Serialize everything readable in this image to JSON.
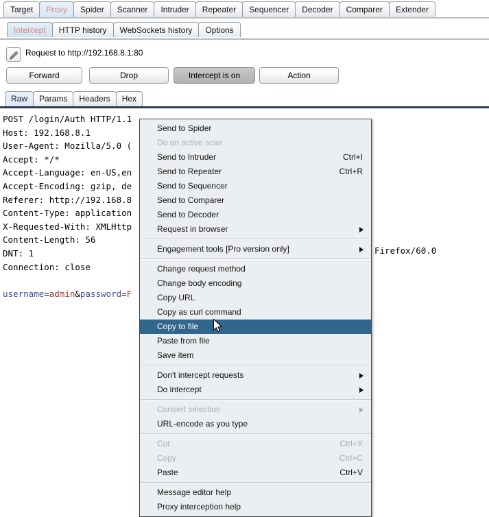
{
  "main_tabs": [
    {
      "label": "Target",
      "selected": false
    },
    {
      "label": "Proxy",
      "selected": true
    },
    {
      "label": "Spider",
      "selected": false
    },
    {
      "label": "Scanner",
      "selected": false
    },
    {
      "label": "Intruder",
      "selected": false
    },
    {
      "label": "Repeater",
      "selected": false
    },
    {
      "label": "Sequencer",
      "selected": false
    },
    {
      "label": "Decoder",
      "selected": false
    },
    {
      "label": "Comparer",
      "selected": false
    },
    {
      "label": "Extender",
      "selected": false
    }
  ],
  "sub_tabs": [
    {
      "label": "Intercept",
      "selected": true
    },
    {
      "label": "HTTP history",
      "selected": false
    },
    {
      "label": "WebSockets history",
      "selected": false
    },
    {
      "label": "Options",
      "selected": false
    }
  ],
  "request": {
    "title": "Request to http://192.168.8.1:80",
    "edit_icon": "pencil-icon"
  },
  "actions": {
    "forward": "Forward",
    "drop": "Drop",
    "intercept": "Intercept is on",
    "action": "Action"
  },
  "editor_tabs": [
    {
      "label": "Raw",
      "selected": true
    },
    {
      "label": "Params",
      "selected": false
    },
    {
      "label": "Headers",
      "selected": false
    },
    {
      "label": "Hex",
      "selected": false
    }
  ],
  "message": {
    "line1": "POST /login/Auth HTTP/1.1",
    "line2": "Host: 192.168.8.1",
    "line3": "User-Agent: Mozilla/5.0 (",
    "line4": "Accept: */*",
    "line5": "Accept-Language: en-US,en",
    "line6": "Accept-Encoding: gzip, de",
    "line7": "Referer: http://192.168.8",
    "line8": "Content-Type: application",
    "line9": "X-Requested-With: XMLHttp",
    "line10": "Content-Length: 56",
    "line11": "DNT: 1",
    "line12": "Connection: close",
    "body_key1": "username",
    "body_eq1": "=",
    "body_val1": "admin",
    "body_amp": "&",
    "body_key2": "password",
    "body_eq2": "=",
    "body_val2": "F",
    "overflow": "Firefox/60.0"
  },
  "context_menu": {
    "groups": [
      {
        "items": [
          {
            "label": "Send to Spider",
            "accel": "",
            "disabled": false,
            "submenu": false,
            "highlight": false
          },
          {
            "label": "Do an active scan",
            "accel": "",
            "disabled": true,
            "submenu": false,
            "highlight": false
          },
          {
            "label": "Send to Intruder",
            "accel": "Ctrl+I",
            "disabled": false,
            "submenu": false,
            "highlight": false
          },
          {
            "label": "Send to Repeater",
            "accel": "Ctrl+R",
            "disabled": false,
            "submenu": false,
            "highlight": false
          },
          {
            "label": "Send to Sequencer",
            "accel": "",
            "disabled": false,
            "submenu": false,
            "highlight": false
          },
          {
            "label": "Send to Comparer",
            "accel": "",
            "disabled": false,
            "submenu": false,
            "highlight": false
          },
          {
            "label": "Send to Decoder",
            "accel": "",
            "disabled": false,
            "submenu": false,
            "highlight": false
          },
          {
            "label": "Request in browser",
            "accel": "",
            "disabled": false,
            "submenu": true,
            "highlight": false
          }
        ]
      },
      {
        "items": [
          {
            "label": "Engagement tools [Pro version only]",
            "accel": "",
            "disabled": false,
            "submenu": true,
            "highlight": false
          }
        ]
      },
      {
        "items": [
          {
            "label": "Change request method",
            "accel": "",
            "disabled": false,
            "submenu": false,
            "highlight": false
          },
          {
            "label": "Change body encoding",
            "accel": "",
            "disabled": false,
            "submenu": false,
            "highlight": false
          },
          {
            "label": "Copy URL",
            "accel": "",
            "disabled": false,
            "submenu": false,
            "highlight": false
          },
          {
            "label": "Copy as curl command",
            "accel": "",
            "disabled": false,
            "submenu": false,
            "highlight": false
          },
          {
            "label": "Copy to file",
            "accel": "",
            "disabled": false,
            "submenu": false,
            "highlight": true
          },
          {
            "label": "Paste from file",
            "accel": "",
            "disabled": false,
            "submenu": false,
            "highlight": false
          },
          {
            "label": "Save item",
            "accel": "",
            "disabled": false,
            "submenu": false,
            "highlight": false
          }
        ]
      },
      {
        "items": [
          {
            "label": "Don't intercept requests",
            "accel": "",
            "disabled": false,
            "submenu": true,
            "highlight": false
          },
          {
            "label": "Do intercept",
            "accel": "",
            "disabled": false,
            "submenu": true,
            "highlight": false
          }
        ]
      },
      {
        "items": [
          {
            "label": "Convert selection",
            "accel": "",
            "disabled": true,
            "submenu": true,
            "highlight": false
          },
          {
            "label": "URL-encode as you type",
            "accel": "",
            "disabled": false,
            "submenu": false,
            "highlight": false
          }
        ]
      },
      {
        "items": [
          {
            "label": "Cut",
            "accel": "Ctrl+X",
            "disabled": true,
            "submenu": false,
            "highlight": false
          },
          {
            "label": "Copy",
            "accel": "Ctrl+C",
            "disabled": true,
            "submenu": false,
            "highlight": false
          },
          {
            "label": "Paste",
            "accel": "Ctrl+V",
            "disabled": false,
            "submenu": false,
            "highlight": false
          }
        ]
      },
      {
        "items": [
          {
            "label": "Message editor help",
            "accel": "",
            "disabled": false,
            "submenu": false,
            "highlight": false
          },
          {
            "label": "Proxy interception help",
            "accel": "",
            "disabled": false,
            "submenu": false,
            "highlight": false
          }
        ]
      }
    ]
  },
  "colors": {
    "menu_highlight": "#31678c",
    "tab_selected_text": "#e08878",
    "editor_underline": "#2e3b4e",
    "syntax_key": "#3f4fa8",
    "syntax_value": "#9c3a2b"
  },
  "cursor": {
    "icon": "mouse-pointer-icon"
  }
}
